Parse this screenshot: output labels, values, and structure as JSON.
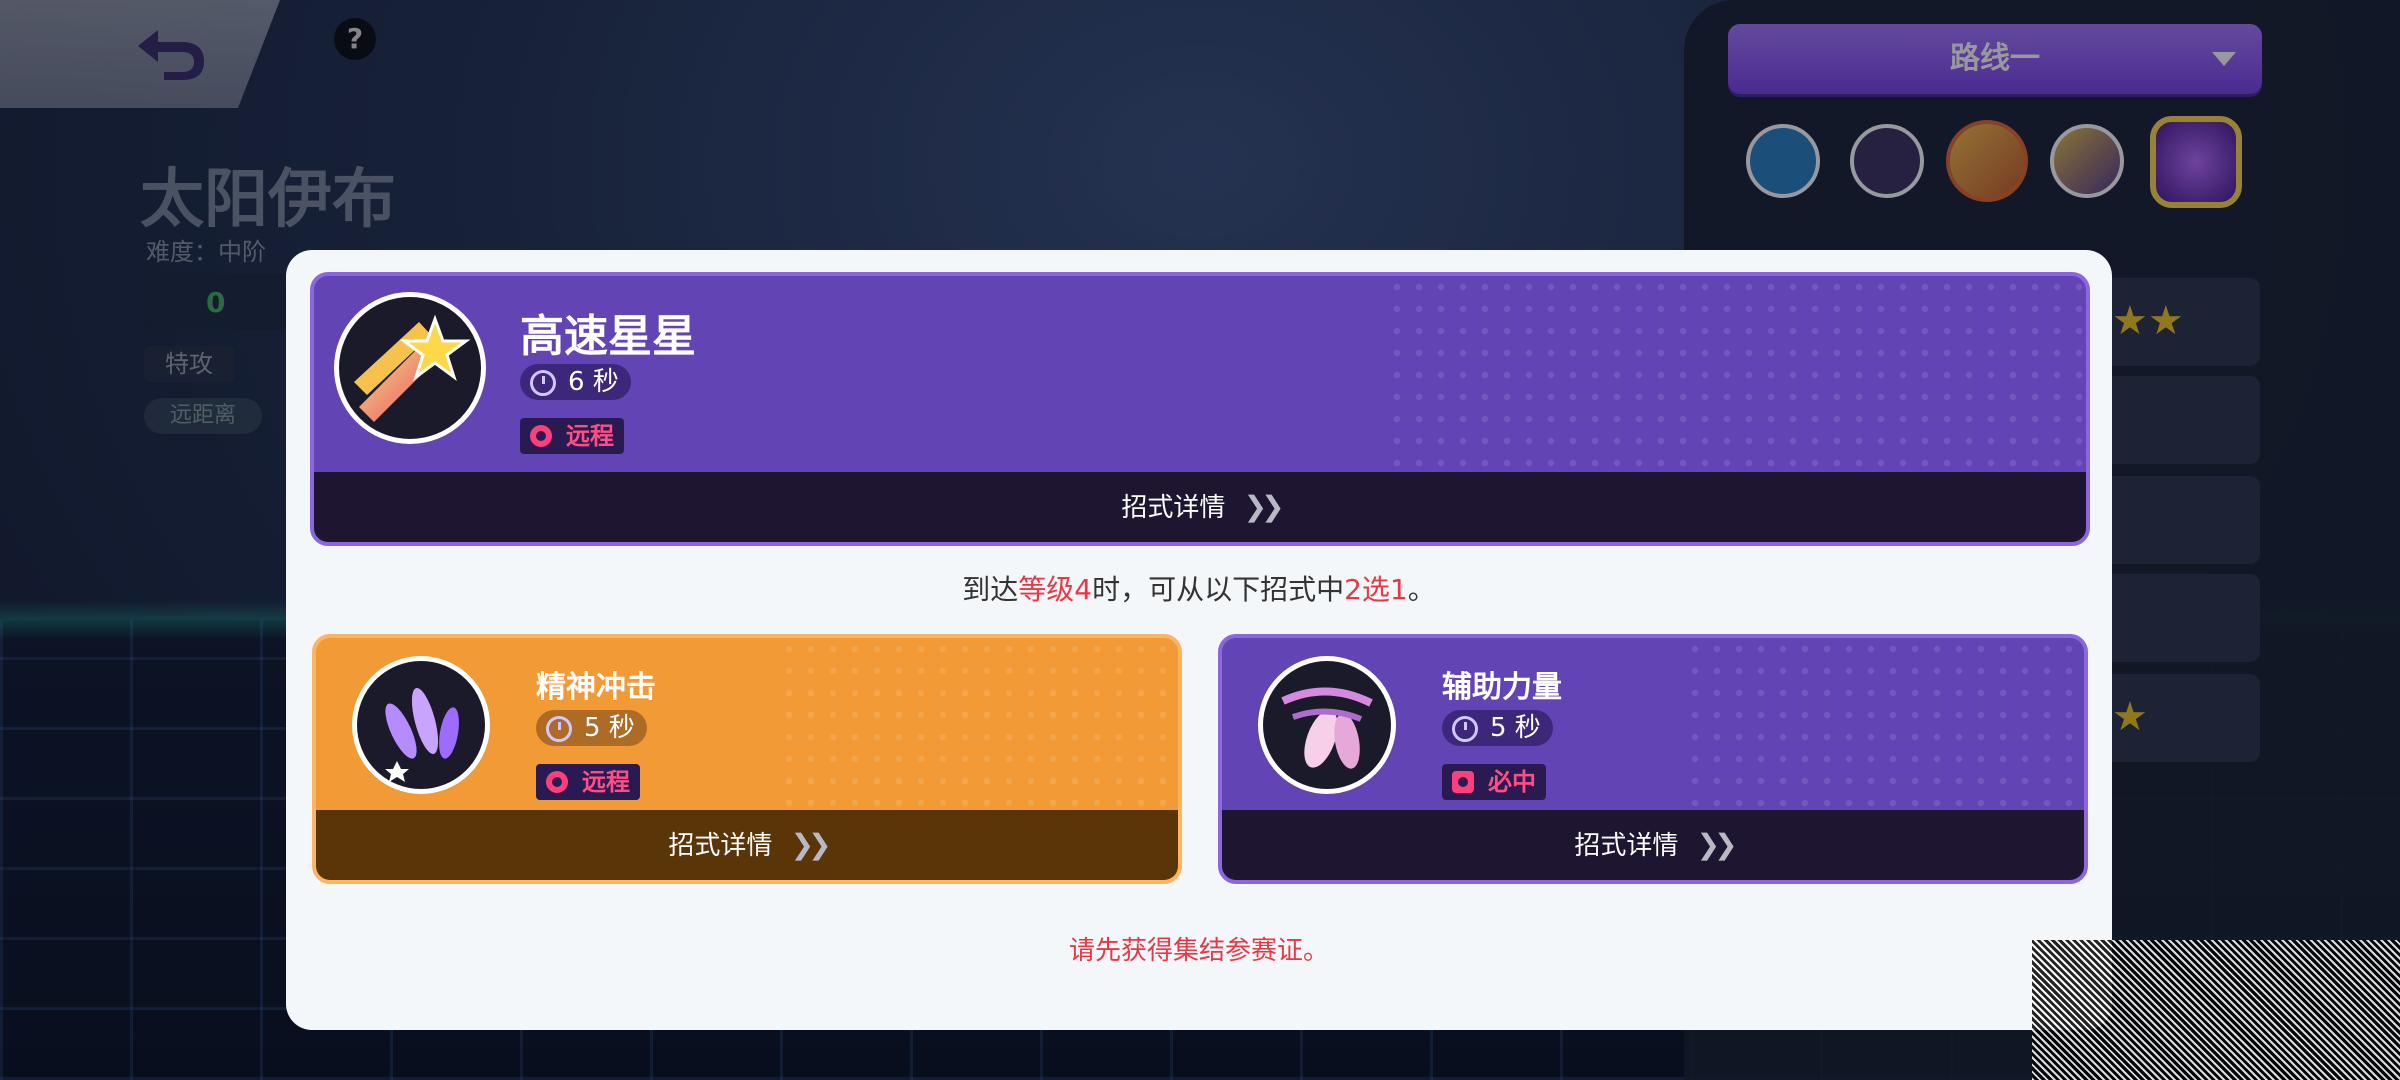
{
  "top": {
    "help": "?"
  },
  "pokemon": {
    "name": "太阳伊布",
    "difficulty": "难度：中阶",
    "stat_value": "0",
    "stat_help": "?",
    "attack_type": "特攻",
    "range_type": "远距离"
  },
  "route": {
    "selected": "路线一"
  },
  "modal": {
    "main_skill": {
      "name": "高速星星",
      "cooldown": "6 秒",
      "range": "远程",
      "details": "招式详情"
    },
    "hint": {
      "p1": "到达",
      "p2": "等级4",
      "p3": "时，可从以下招式中",
      "p4": "2选1",
      "p5": "。"
    },
    "options": [
      {
        "name": "精神冲击",
        "cooldown": "5 秒",
        "range": "远程",
        "details": "招式详情"
      },
      {
        "name": "辅助力量",
        "cooldown": "5 秒",
        "range": "必中",
        "details": "招式详情"
      }
    ],
    "warning": "请先获得集结参赛证。"
  },
  "colors": {
    "purple": "#6344b5",
    "orange": "#f29a35",
    "red": "#e63946",
    "accent": "#8f5bf2"
  }
}
